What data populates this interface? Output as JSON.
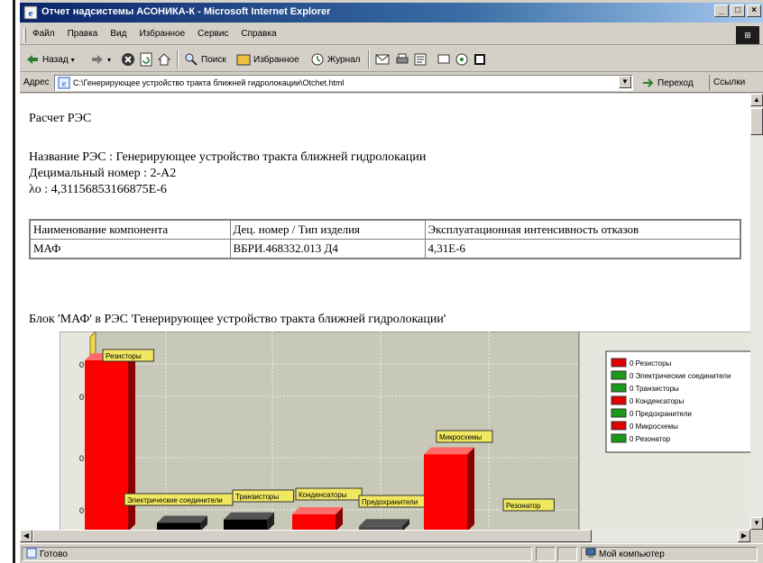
{
  "window": {
    "title": "Отчет надсистемы АСОНИКА-К - Microsoft Internet Explorer",
    "min_label": "_",
    "max_label": "□",
    "close_label": "×"
  },
  "menu": {
    "items": [
      "Файл",
      "Правка",
      "Вид",
      "Избранное",
      "Сервис",
      "Справка"
    ]
  },
  "toolbar": {
    "back_label": "Назад",
    "search_label": "Поиск",
    "favorites_label": "Избранное",
    "history_label": "Журнал"
  },
  "address": {
    "label": "Адрес",
    "value": "C:\\Генерирующее устройство тракта ближней гидролокации\\Otchet.html",
    "go_label": "Переход",
    "links_label": "Ссылки"
  },
  "report": {
    "heading": "Расчет РЭС",
    "name_line": "Название РЭС : Генерирующее устройство тракта ближней гидролокации",
    "decimal_line": "Децимальный номер : 2-А2",
    "lambda_line": "λо : 4,31156853166875Е-6",
    "table": {
      "headers": [
        "Наименование компонента",
        "Дец. номер / Тип изделия",
        "Эксплуатационная интенсивность отказов"
      ],
      "rows": [
        [
          "МАФ",
          "ВБРИ.468332.013 Д4",
          "4,31Е-6"
        ]
      ]
    },
    "block_caption": "Блок 'МАФ' в РЭС 'Генерирующее устройство тракта ближней гидролокации'"
  },
  "chart_data": {
    "type": "bar",
    "categories": [
      "Резисторы",
      "Электрические соединители",
      "Транзисторы",
      "Конденсаторы",
      "Предохранители",
      "Микросхемы",
      "Резонатор"
    ],
    "values": [
      1.0,
      0.05,
      0.07,
      0.1,
      0.03,
      0.45,
      0.0
    ],
    "colors": [
      "#ff0000",
      "#000000",
      "#000000",
      "#ff0000",
      "#4a4a4a",
      "#ff0000",
      "#ffffff"
    ],
    "ytick_label": "0",
    "legend": {
      "placement": "right",
      "entries": [
        {
          "label": "0 Резисторы",
          "color": "#e00000"
        },
        {
          "label": "0 Электрические соединители",
          "color": "#1a9a1a"
        },
        {
          "label": "0 Транзисторы",
          "color": "#1a9a1a"
        },
        {
          "label": "0 Конденсаторы",
          "color": "#e00000"
        },
        {
          "label": "0 Предохранители",
          "color": "#1a9a1a"
        },
        {
          "label": "0 Микросхемы",
          "color": "#e00000"
        },
        {
          "label": "0 Резонатор",
          "color": "#1a9a1a"
        }
      ]
    },
    "grid": true
  },
  "status": {
    "left": "Готово",
    "zone": "Мой компьютер"
  }
}
